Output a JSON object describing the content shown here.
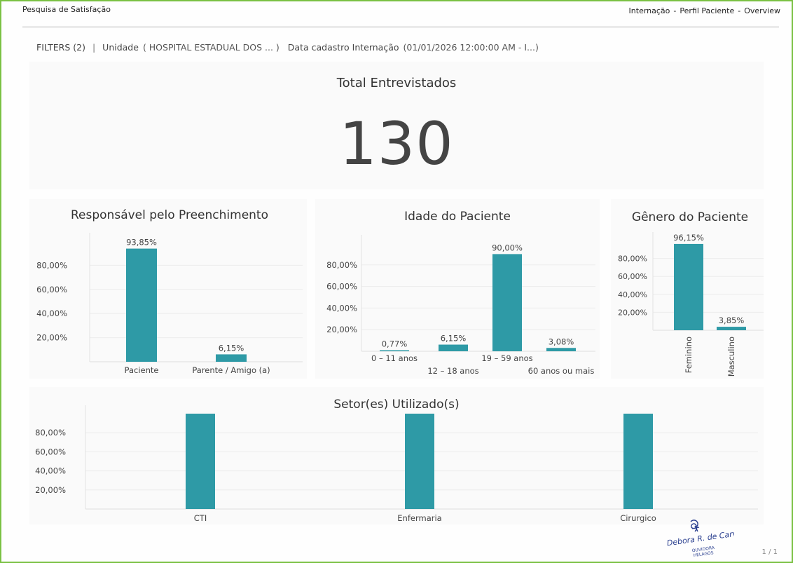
{
  "header": {
    "left_title": "Pesquisa de Satisfação",
    "breadcrumb": [
      "Internação",
      "Perfil Paciente",
      "Overview"
    ],
    "breadcrumb_sep": "-"
  },
  "filters": {
    "label": "FILTERS (2)",
    "separator": "|",
    "unidade_label": "Unidade",
    "unidade_value": "( HOSPITAL ESTADUAL DOS ... )",
    "data_label": "Data cadastro Internação",
    "data_value": "(01/01/2026 12:00:00 AM - I...)"
  },
  "kpi": {
    "title": "Total Entrevistados",
    "value": "130"
  },
  "colors": {
    "bar": "#2e9aa6",
    "grid": "#ececec",
    "frame": "#7ac143"
  },
  "chart_data": [
    {
      "type": "bar",
      "title": "Responsável pelo Preenchimento",
      "categories": [
        "Paciente",
        "Parente / Amigo (a)"
      ],
      "values": [
        93.85,
        6.15
      ],
      "labels": [
        "93,85%",
        "6,15%"
      ],
      "yticks": [
        "20,00%",
        "40,00%",
        "60,00%",
        "80,00%"
      ],
      "ylim": [
        0,
        100
      ]
    },
    {
      "type": "bar",
      "title": "Idade do Paciente",
      "categories": [
        "0 – 11 anos",
        "12 – 18 anos",
        "19 – 59 anos",
        "60 anos ou mais"
      ],
      "values": [
        0.77,
        6.15,
        90.0,
        3.08
      ],
      "labels": [
        "0,77%",
        "6,15%",
        "90,00%",
        "3,08%"
      ],
      "yticks": [
        "20,00%",
        "40,00%",
        "60,00%",
        "80,00%"
      ],
      "ylim": [
        0,
        100
      ]
    },
    {
      "type": "bar",
      "title": "Gênero do Paciente",
      "categories": [
        "Feminino",
        "Masculino"
      ],
      "values": [
        96.15,
        3.85
      ],
      "labels": [
        "96,15%",
        "3,85%"
      ],
      "yticks": [
        "20,00%",
        "40,00%",
        "60,00%",
        "80,00%"
      ],
      "ylim": [
        0,
        100
      ]
    },
    {
      "type": "bar",
      "title": "Setor(es) Utilizado(s)",
      "categories": [
        "CTI",
        "Enfermaria",
        "Cirurgico"
      ],
      "values": [
        100,
        100,
        100
      ],
      "labels": [
        "",
        "",
        ""
      ],
      "yticks": [
        "20,00%",
        "40,00%",
        "60,00%",
        "80,00%"
      ],
      "ylim": [
        0,
        100
      ]
    }
  ],
  "signature": {
    "name": "Debora R. de Carvalho",
    "role": "OUVIDORA",
    "org": "HELAGOS"
  },
  "footer": {
    "page": "1 / 1"
  }
}
